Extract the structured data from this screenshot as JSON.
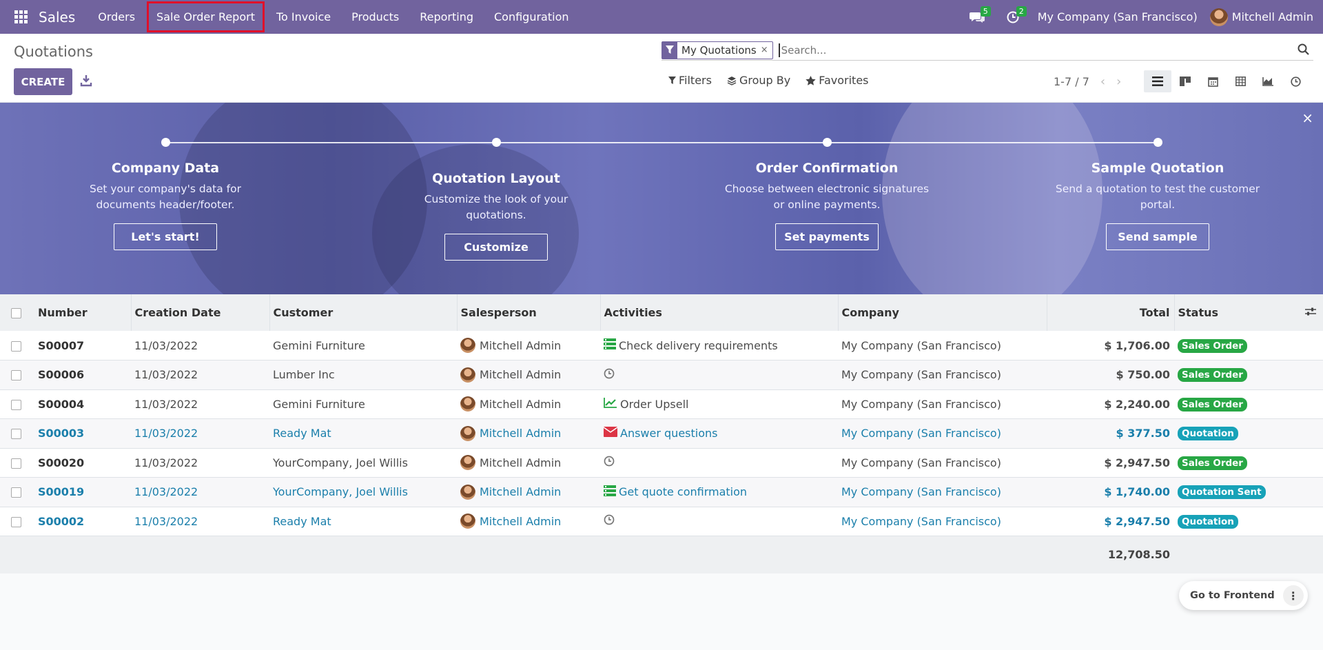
{
  "navbar": {
    "app_name": "Sales",
    "menu": [
      "Orders",
      "Sale Order Report",
      "To Invoice",
      "Products",
      "Reporting",
      "Configuration"
    ],
    "messages_count": "5",
    "activities_count": "2",
    "company": "My Company (San Francisco)",
    "user": "Mitchell Admin"
  },
  "control_panel": {
    "title": "Quotations",
    "create_label": "CREATE",
    "search": {
      "facet": "My Quotations",
      "facet_close": "×",
      "placeholder": "Search..."
    },
    "filters_label": "Filters",
    "groupby_label": "Group By",
    "favorites_label": "Favorites",
    "pager": "1-7 / 7"
  },
  "banner": {
    "close": "×",
    "steps": [
      {
        "title": "Company Data",
        "desc": "Set your company's data for documents header/footer.",
        "button": "Let's start!"
      },
      {
        "title": "Quotation Layout",
        "desc": "Customize the look of your quotations.",
        "button": "Customize"
      },
      {
        "title": "Order Confirmation",
        "desc": "Choose between electronic signatures or online payments.",
        "button": "Set payments"
      },
      {
        "title": "Sample Quotation",
        "desc": "Send a quotation to test the customer portal.",
        "button": "Send sample"
      }
    ]
  },
  "table": {
    "columns": [
      "Number",
      "Creation Date",
      "Customer",
      "Salesperson",
      "Activities",
      "Company",
      "Total",
      "Status"
    ],
    "rows": [
      {
        "number": "S00007",
        "date": "11/03/2022",
        "customer": "Gemini Furniture",
        "salesperson": "Mitchell Admin",
        "activity": "Check delivery requirements",
        "activity_icon": "todo-list-icon",
        "company": "My Company (San Francisco)",
        "total": "$ 1,706.00",
        "status": "Sales Order",
        "status_color": "#28a745"
      },
      {
        "number": "S00006",
        "date": "11/03/2022",
        "customer": "Lumber Inc",
        "salesperson": "Mitchell Admin",
        "activity": "",
        "activity_icon": "clock-icon",
        "company": "My Company (San Francisco)",
        "total": "$ 750.00",
        "status": "Sales Order",
        "status_color": "#28a745"
      },
      {
        "number": "S00004",
        "date": "11/03/2022",
        "customer": "Gemini Furniture",
        "salesperson": "Mitchell Admin",
        "activity": "Order Upsell",
        "activity_icon": "chart-line-icon",
        "company": "My Company (San Francisco)",
        "total": "$ 2,240.00",
        "status": "Sales Order",
        "status_color": "#28a745"
      },
      {
        "number": "S00003",
        "date": "11/03/2022",
        "customer": "Ready Mat",
        "salesperson": "Mitchell Admin",
        "activity": "Answer questions",
        "activity_icon": "envelope-icon",
        "company": "My Company (San Francisco)",
        "total": "$ 377.50",
        "status": "Quotation",
        "status_color": "#17a2b8"
      },
      {
        "number": "S00020",
        "date": "11/03/2022",
        "customer": "YourCompany, Joel Willis",
        "salesperson": "Mitchell Admin",
        "activity": "",
        "activity_icon": "clock-icon",
        "company": "My Company (San Francisco)",
        "total": "$ 2,947.50",
        "status": "Sales Order",
        "status_color": "#28a745"
      },
      {
        "number": "S00019",
        "date": "11/03/2022",
        "customer": "YourCompany, Joel Willis",
        "salesperson": "Mitchell Admin",
        "activity": "Get quote confirmation",
        "activity_icon": "todo-list-icon",
        "company": "My Company (San Francisco)",
        "total": "$ 1,740.00",
        "status": "Quotation Sent",
        "status_color": "#17a2b8"
      },
      {
        "number": "S00002",
        "date": "11/03/2022",
        "customer": "Ready Mat",
        "salesperson": "Mitchell Admin",
        "activity": "",
        "activity_icon": "clock-icon",
        "company": "My Company (San Francisco)",
        "total": "$ 2,947.50",
        "status": "Quotation",
        "status_color": "#17a2b8"
      }
    ],
    "grand_total": "12,708.50"
  },
  "floating": {
    "frontend_label": "Go to Frontend",
    "more": "⋮"
  },
  "colors": {
    "brand": "#71639e",
    "link": "#1b7fab",
    "sale_order": "#28a745",
    "quotation": "#17a2b8"
  }
}
